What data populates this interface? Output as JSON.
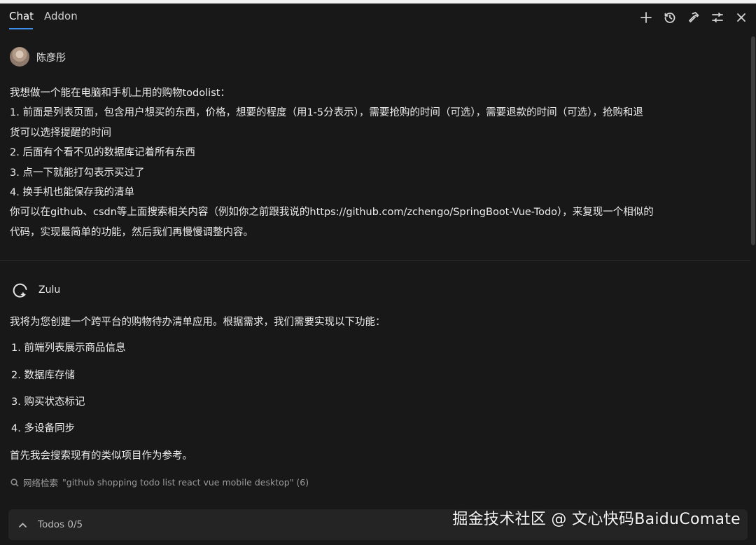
{
  "tabs": [
    {
      "label": "Chat",
      "active": true
    },
    {
      "label": "Addon",
      "active": false
    }
  ],
  "toolbar_icons": [
    "plus-icon",
    "history-icon",
    "hammer-icon",
    "sliders-icon",
    "close-icon"
  ],
  "colors": {
    "accent": "#3b8eea",
    "background": "#181818",
    "panel": "#242424"
  },
  "user_message": {
    "author": "陈彦彤",
    "lines": [
      "我想做一个能在电脑和手机上用的购物todolist：",
      "1. 前面是列表页面，包含用户想买的东西，价格，想要的程度（用1-5分表示），需要抢购的时间（可选），需要退款的时间（可选），抢购和退",
      "货可以选择提醒的时间",
      "2. 后面有个看不见的数据库记着所有东西",
      "3. 点一下就能打勾表示买过了",
      "4. 换手机也能保存我的清单",
      "你可以在github、csdn等上面搜索相关内容（例如你之前跟我说的https://github.com/zchengo/SpringBoot-Vue-Todo），来复现一个相似的",
      "代码，实现最简单的功能，然后我们再慢慢调整内容。"
    ]
  },
  "bot_message": {
    "author": "Zulu",
    "intro": "我将为您创建一个跨平台的购物待办清单应用。根据需求，我们需要实现以下功能：",
    "items": [
      "1. 前端列表展示商品信息",
      "2. 数据库存储",
      "3. 购买状态标记",
      "4. 多设备同步"
    ],
    "outro": "首先我会搜索现有的类似项目作为参考。",
    "search": {
      "label": "网络检索",
      "query": "\"github shopping todo list react vue mobile desktop\" (6)"
    }
  },
  "todos": {
    "label": "Todos 0/5"
  },
  "watermark": "掘金技术社区 @ 文心快码BaiduComate"
}
